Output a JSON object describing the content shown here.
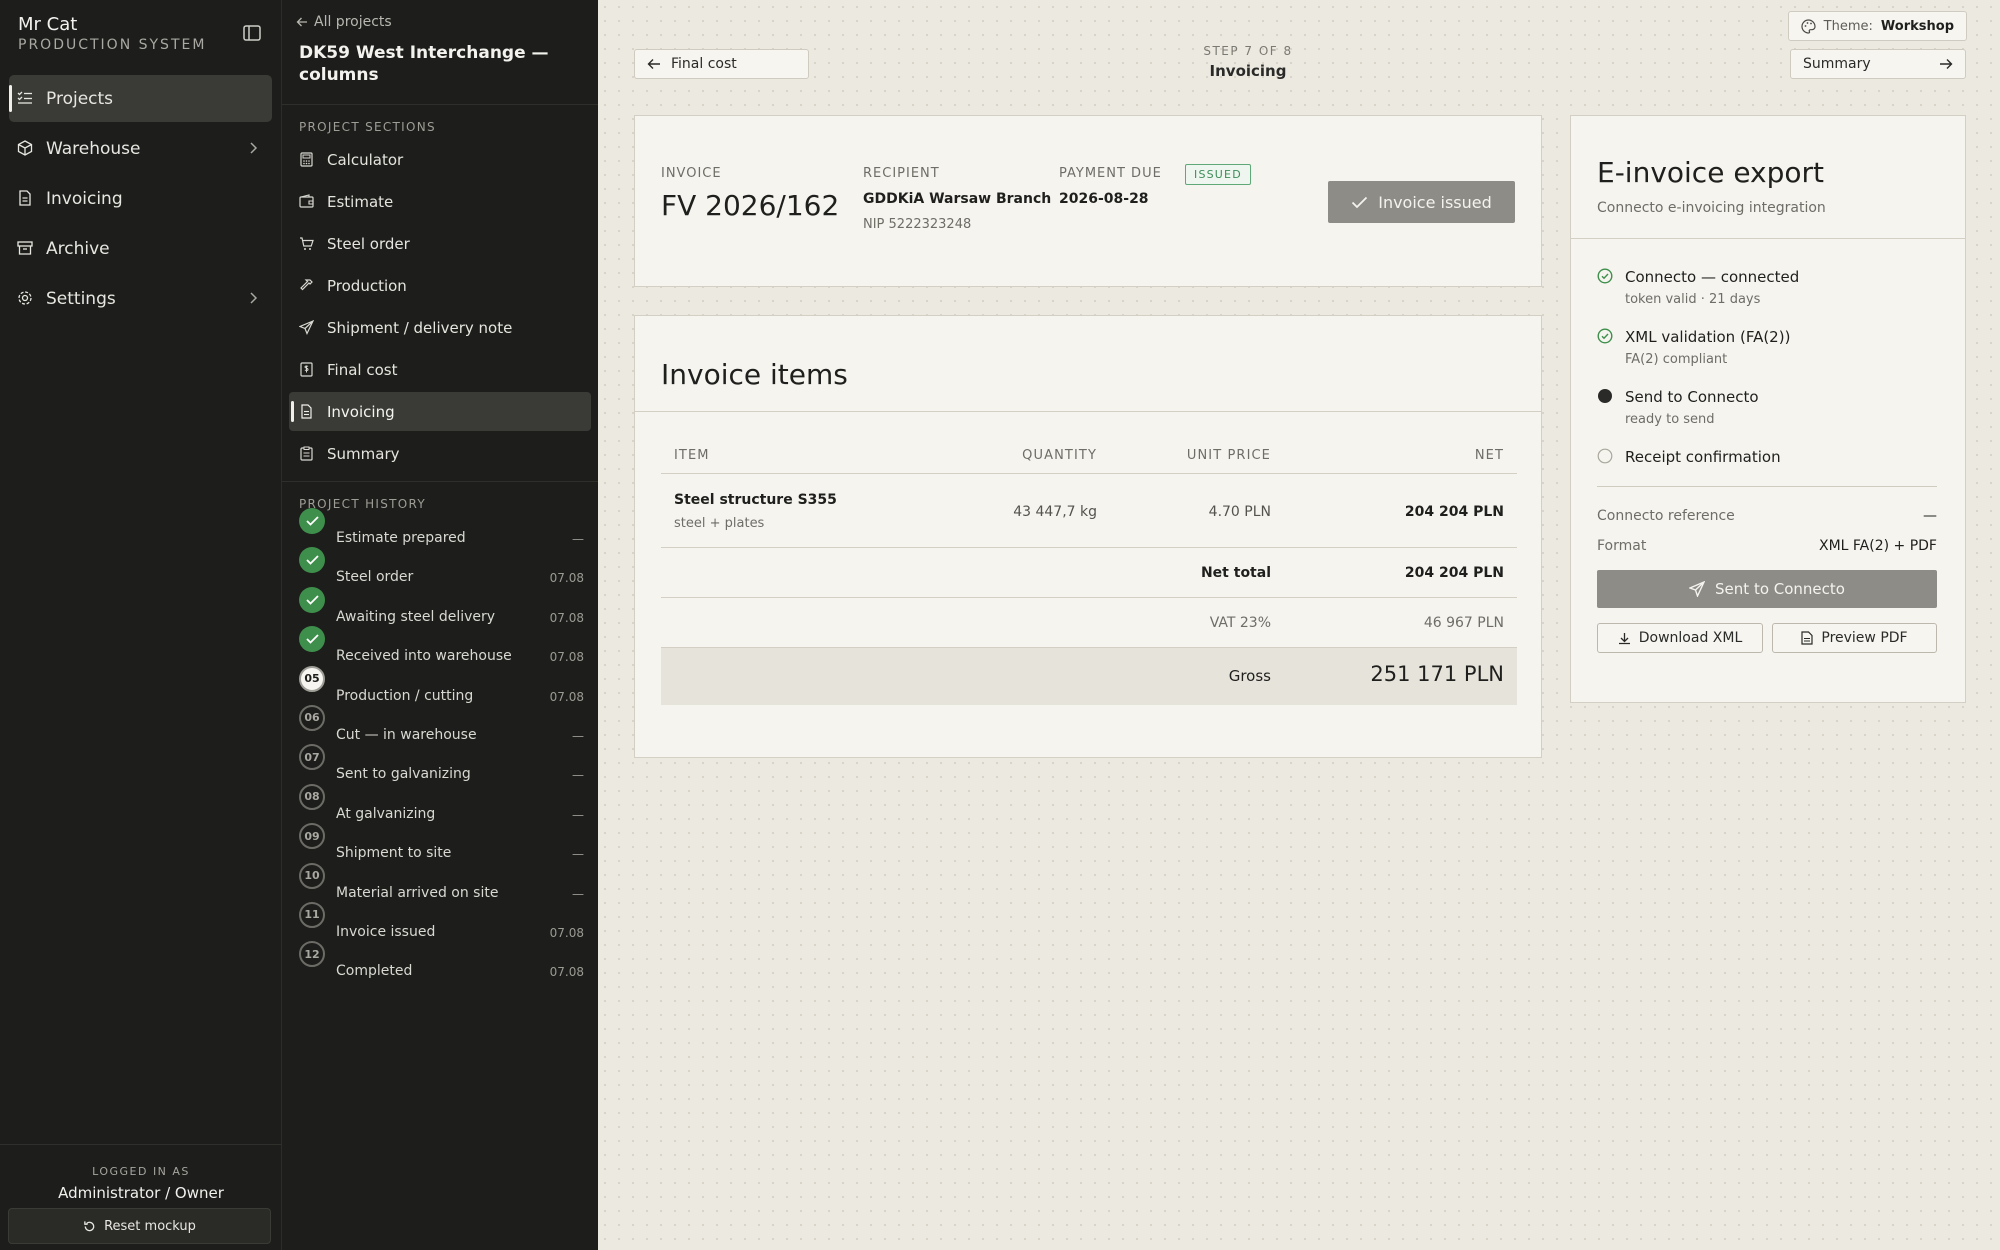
{
  "app": {
    "name": "Mr Cat",
    "subtitle": "PRODUCTION SYSTEM"
  },
  "nav": [
    {
      "label": "Projects",
      "icon": "list-check-icon",
      "active": true,
      "expandable": false
    },
    {
      "label": "Warehouse",
      "icon": "box-icon",
      "active": false,
      "expandable": true
    },
    {
      "label": "Invoicing",
      "icon": "document-icon",
      "active": false,
      "expandable": false
    },
    {
      "label": "Archive",
      "icon": "archive-icon",
      "active": false,
      "expandable": false
    },
    {
      "label": "Settings",
      "icon": "gear-icon",
      "active": false,
      "expandable": true
    }
  ],
  "session": {
    "label": "LOGGED IN AS",
    "user": "Administrator / Owner",
    "reset_label": "Reset mockup"
  },
  "project": {
    "back_label": "All projects",
    "title": "DK59 West Interchange — columns",
    "sections_label": "PROJECT SECTIONS",
    "sections": [
      {
        "label": "Calculator",
        "icon": "calculator-icon",
        "active": false
      },
      {
        "label": "Estimate",
        "icon": "wallet-icon",
        "active": false
      },
      {
        "label": "Steel order",
        "icon": "cart-icon",
        "active": false
      },
      {
        "label": "Production",
        "icon": "hammer-icon",
        "active": false
      },
      {
        "label": "Shipment / delivery note",
        "icon": "send-icon",
        "active": false
      },
      {
        "label": "Final cost",
        "icon": "receipt-icon",
        "active": false
      },
      {
        "label": "Invoicing",
        "icon": "document-icon",
        "active": true
      },
      {
        "label": "Summary",
        "icon": "clipboard-icon",
        "active": false
      }
    ],
    "history_label": "PROJECT HISTORY",
    "history": [
      {
        "marker": "",
        "status": "done",
        "label": "Estimate prepared",
        "date": "—"
      },
      {
        "marker": "",
        "status": "done",
        "label": "Steel order",
        "date": "07.08"
      },
      {
        "marker": "",
        "status": "done",
        "label": "Awaiting steel delivery",
        "date": "07.08"
      },
      {
        "marker": "",
        "status": "done",
        "label": "Received into warehouse",
        "date": "07.08"
      },
      {
        "marker": "05",
        "status": "current",
        "label": "Production / cutting",
        "date": "07.08"
      },
      {
        "marker": "06",
        "status": "pending",
        "label": "Cut — in warehouse",
        "date": "—"
      },
      {
        "marker": "07",
        "status": "pending",
        "label": "Sent to galvanizing",
        "date": "—"
      },
      {
        "marker": "08",
        "status": "pending",
        "label": "At galvanizing",
        "date": "—"
      },
      {
        "marker": "09",
        "status": "pending",
        "label": "Shipment to site",
        "date": "—"
      },
      {
        "marker": "10",
        "status": "pending",
        "label": "Material arrived on site",
        "date": "—"
      },
      {
        "marker": "11",
        "status": "pending",
        "label": "Invoice issued",
        "date": "07.08"
      },
      {
        "marker": "12",
        "status": "pending",
        "label": "Completed",
        "date": "07.08"
      }
    ]
  },
  "topbar": {
    "theme_label": "Theme:",
    "theme_value": "Workshop",
    "prev_label": "Final cost",
    "next_label": "Summary",
    "step_count": "STEP 7 OF 8",
    "step_name": "Invoicing"
  },
  "invoice": {
    "number_label": "INVOICE",
    "number": "FV 2026/162",
    "recipient_label": "RECIPIENT",
    "recipient": "GDDKiA Warsaw Branch",
    "recipient_nip": "NIP 5222323248",
    "due_label": "PAYMENT DUE",
    "due": "2026-08-28",
    "status": "ISSUED",
    "issued_button": "Invoice issued"
  },
  "items": {
    "title": "Invoice items",
    "columns": {
      "item": "ITEM",
      "quantity": "QUANTITY",
      "unit_price": "UNIT PRICE",
      "net": "NET"
    },
    "rows": [
      {
        "name": "Steel structure S355",
        "sub": "steel + plates",
        "quantity": "43 447,7 kg",
        "unit_price": "4.70 PLN",
        "net": "204 204 PLN"
      }
    ],
    "net_total_label": "Net total",
    "net_total": "204 204 PLN",
    "vat_label": "VAT 23%",
    "vat": "46 967 PLN",
    "gross_label": "Gross",
    "gross": "251 171 PLN"
  },
  "export": {
    "title": "E-invoice export",
    "subtitle": "Connecto e-invoicing integration",
    "steps": [
      {
        "label": "Connecto — connected",
        "sub": "token valid · 21 days",
        "state": "done"
      },
      {
        "label": "XML validation (FA(2))",
        "sub": "FA(2) compliant",
        "state": "done"
      },
      {
        "label": "Send to Connecto",
        "sub": "ready to send",
        "state": "current"
      },
      {
        "label": "Receipt confirmation",
        "sub": "",
        "state": "pending"
      }
    ],
    "reference_label": "Connecto reference",
    "reference_value": "—",
    "format_label": "Format",
    "format_value": "XML FA(2) + PDF",
    "sent_button": "Sent to Connecto",
    "download_xml": "Download XML",
    "preview_pdf": "Preview PDF"
  },
  "colors": {
    "done": "#3f8f4c",
    "sidebar": "#1d1d1b",
    "canvas": "#ece9e1",
    "card": "#f5f4ef"
  }
}
